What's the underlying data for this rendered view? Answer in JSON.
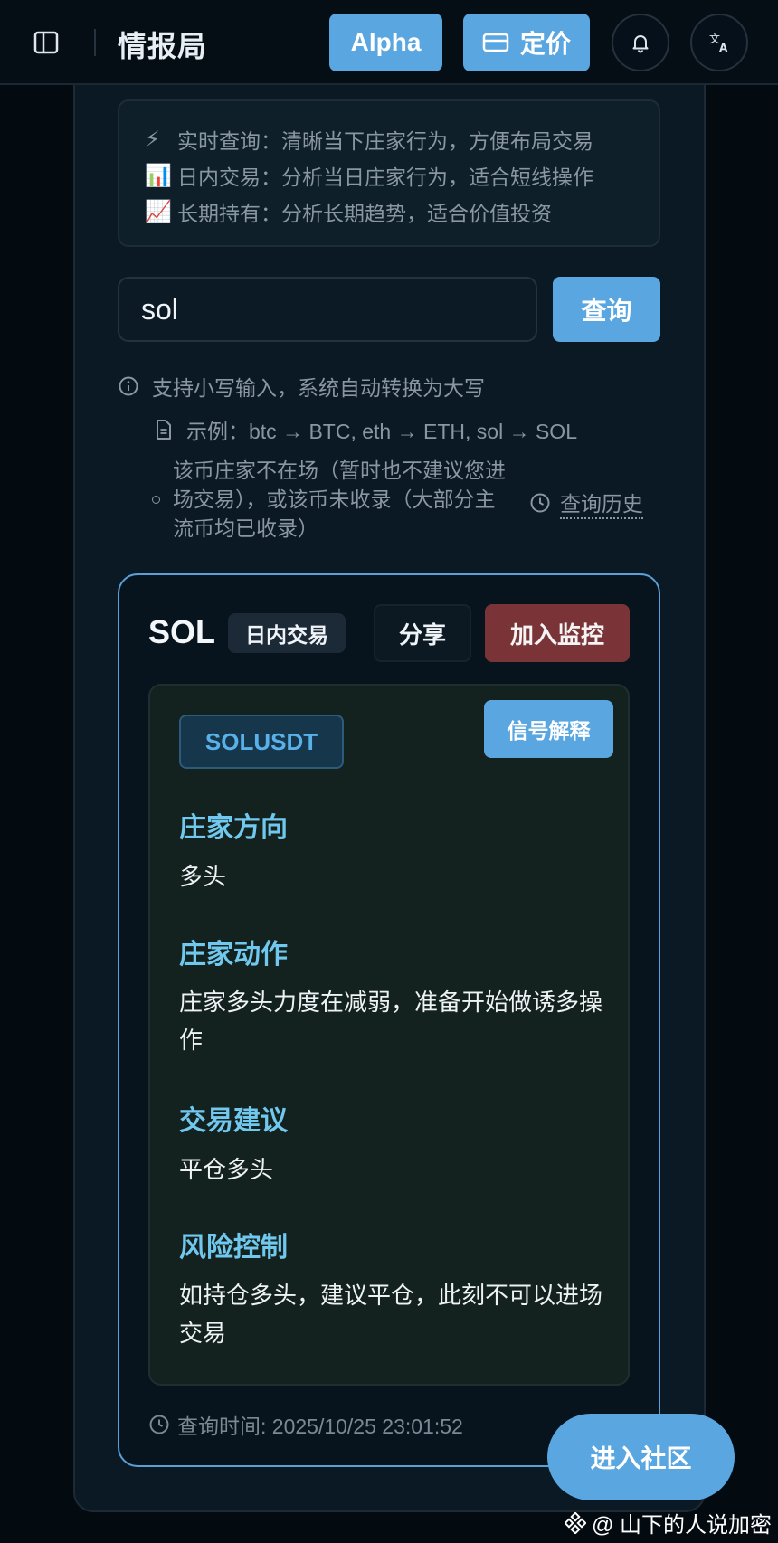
{
  "header": {
    "title": "情报局",
    "alpha_label": "Alpha",
    "pricing_label": "定价"
  },
  "intro": {
    "lines": [
      {
        "emoji": "⚡",
        "text": "实时查询：清晰当下庄家行为，方便布局交易"
      },
      {
        "emoji": "📊",
        "text": "日内交易：分析当日庄家行为，适合短线操作"
      },
      {
        "emoji": "📈",
        "text": "长期持有：分析长期趋势，适合价值投资"
      }
    ]
  },
  "search": {
    "value": "sol",
    "button_label": "查询"
  },
  "hints": {
    "lowercase": "支持小写输入，系统自动转换为大写",
    "example": "示例：btc → BTC, eth → ETH, sol → SOL",
    "notice": "该币庄家不在场（暂时也不建议您进场交易），或该币未收录（大部分主流币均已收录）",
    "history_label": "查询历史"
  },
  "result": {
    "symbol": "SOL",
    "mode": "日内交易",
    "share_label": "分享",
    "monitor_label": "加入监控",
    "pair": "SOLUSDT",
    "explain_label": "信号解释",
    "sections": [
      {
        "title": "庄家方向",
        "text": "多头"
      },
      {
        "title": "庄家动作",
        "text": "庄家多头力度在减弱，准备开始做诱多操作"
      },
      {
        "title": "交易建议",
        "text": "平仓多头"
      },
      {
        "title": "风险控制",
        "text": "如持仓多头，建议平仓，此刻不可以进场交易"
      }
    ],
    "query_time": "查询时间: 2025/10/25 23:01:52"
  },
  "community_label": "进入社区",
  "watermark": "@ 山下的人说加密",
  "colors": {
    "accent": "#5aa6e0",
    "danger": "#7a3336",
    "section_title": "#70c8ee"
  }
}
